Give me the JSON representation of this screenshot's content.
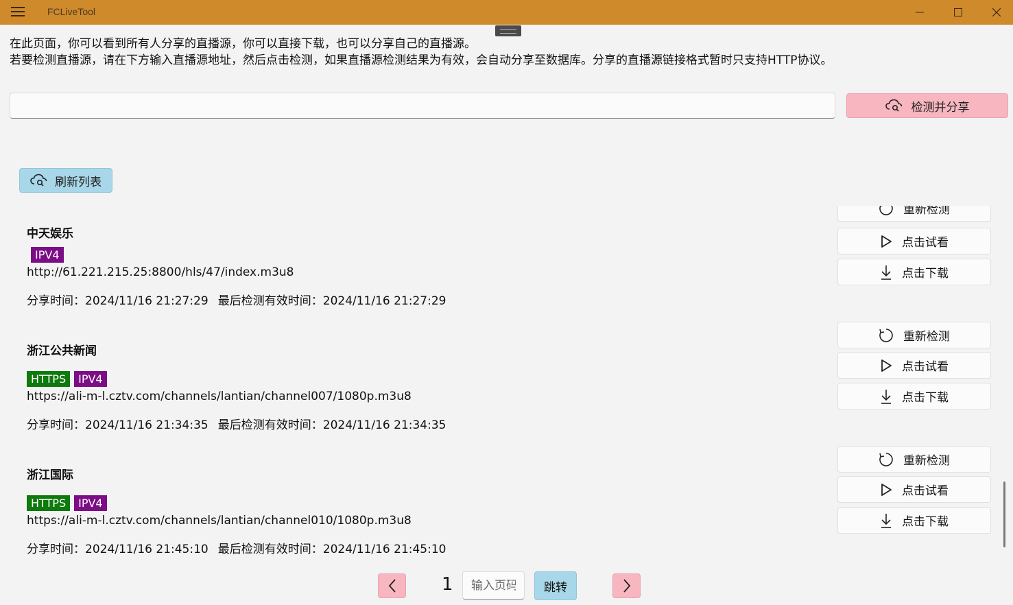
{
  "window": {
    "title": "FCLiveTool"
  },
  "intro": {
    "line1": "在此页面，你可以看到所有人分享的直播源，你可以直接下载，也可以分享自己的直播源。",
    "line2": "若要检测直播源，请在下方输入直播源地址，然后点击检测，如果直播源检测结果为有效，会自动分享至数据库。分享的直播源链接格式暂时只支持HTTP协议。"
  },
  "share_form": {
    "url_value": "",
    "share_label": "检测并分享"
  },
  "refresh_label": "刷新列表",
  "actions": {
    "recheck": "重新检测",
    "preview": "点击试看",
    "download": "点击下载"
  },
  "sources": [
    {
      "name": "中天娱乐",
      "tags": [
        "IPV4"
      ],
      "url": "http://61.221.215.25:8800/hls/47/index.m3u8",
      "share_time_label": "分享时间：",
      "share_time": "2024/11/16 21:27:29",
      "check_time_label": "最后检测有效时间：",
      "check_time": "2024/11/16 21:27:29"
    },
    {
      "name": "浙江公共新闻",
      "tags": [
        "HTTPS",
        "IPV4"
      ],
      "url": "https://ali-m-l.cztv.com/channels/lantian/channel007/1080p.m3u8",
      "share_time_label": "分享时间：",
      "share_time": "2024/11/16 21:34:35",
      "check_time_label": "最后检测有效时间：",
      "check_time": "2024/11/16 21:34:35"
    },
    {
      "name": "浙江国际",
      "tags": [
        "HTTPS",
        "IPV4"
      ],
      "url": "https://ali-m-l.cztv.com/channels/lantian/channel010/1080p.m3u8",
      "share_time_label": "分享时间：",
      "share_time": "2024/11/16 21:45:10",
      "check_time_label": "最后检测有效时间：",
      "check_time": "2024/11/16 21:45:10"
    }
  ],
  "pagination": {
    "current_page": "1",
    "page_input_placeholder": "输入页码",
    "jump_label": "跳转"
  },
  "colors": {
    "titlebar": "#cf8a2c",
    "share_button": "#f7b6c0",
    "refresh_button": "#a7d7e8",
    "tag_https": "#0e7a0d",
    "tag_ipv4": "#7d0d86"
  }
}
